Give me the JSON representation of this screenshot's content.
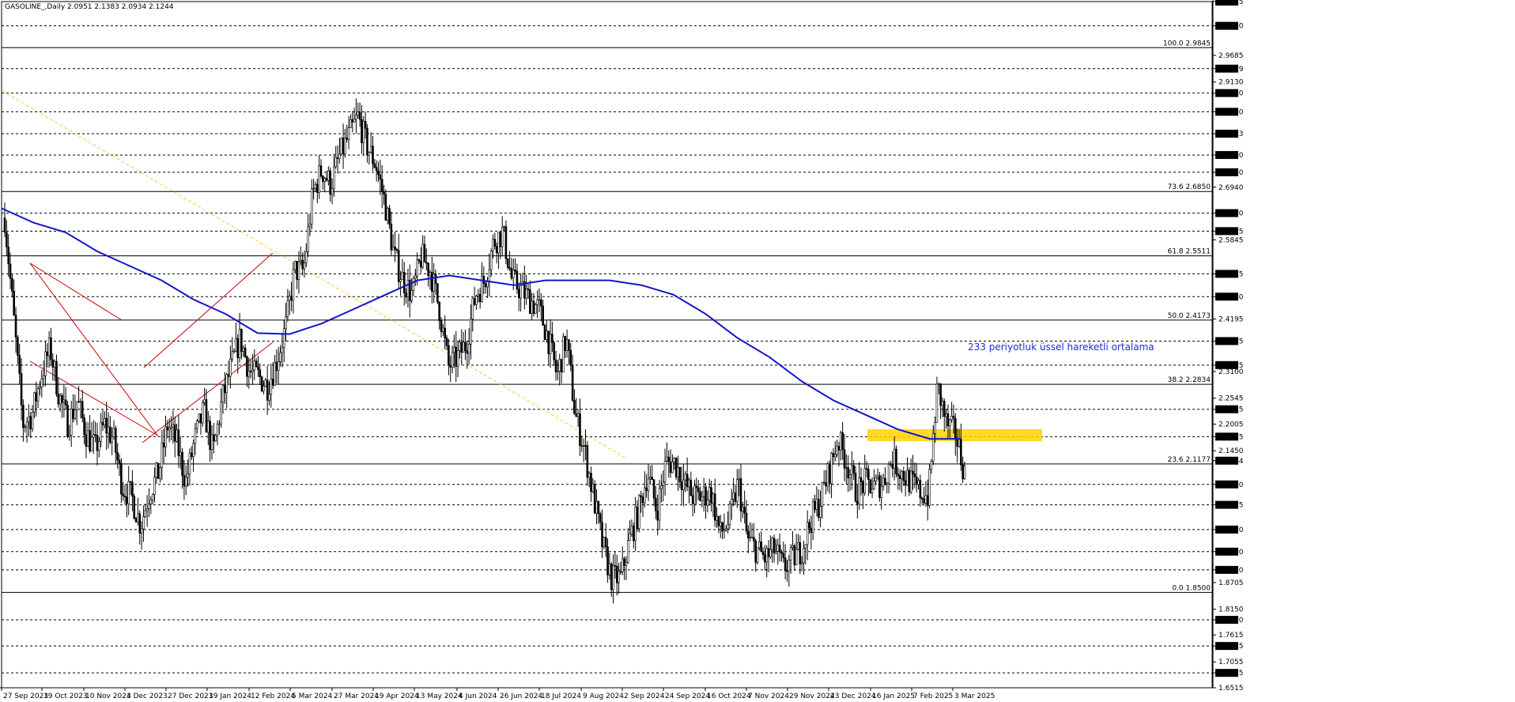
{
  "header": {
    "title": "GASOLINE_,Daily  2.0951 2.1383 2.0934 2.1244"
  },
  "chart_data": {
    "type": "candlestick",
    "symbol": "GASOLINE_",
    "timeframe": "Daily",
    "last_ohlc": {
      "open": 2.0951,
      "high": 2.1383,
      "low": 2.0934,
      "close": 2.1244
    },
    "ylim": [
      1.6515,
      3.0805
    ],
    "price_axis_ticks": [
      {
        "v": 3.0805,
        "boxed": true
      },
      {
        "v": 3.03,
        "boxed": true
      },
      {
        "v": 2.9685,
        "boxed": false
      },
      {
        "v": 2.9409,
        "boxed": true
      },
      {
        "v": 2.913,
        "boxed": false
      },
      {
        "v": 2.89,
        "boxed": true
      },
      {
        "v": 2.851,
        "boxed": true
      },
      {
        "v": 2.8053,
        "boxed": true
      },
      {
        "v": 2.761,
        "boxed": true
      },
      {
        "v": 2.725,
        "boxed": true
      },
      {
        "v": 2.694,
        "boxed": false
      },
      {
        "v": 2.64,
        "boxed": true
      },
      {
        "v": 2.6025,
        "boxed": true
      },
      {
        "v": 2.5845,
        "boxed": false
      },
      {
        "v": 2.5135,
        "boxed": true
      },
      {
        "v": 2.466,
        "boxed": true
      },
      {
        "v": 2.4195,
        "boxed": false
      },
      {
        "v": 2.3735,
        "boxed": true
      },
      {
        "v": 2.3235,
        "boxed": true
      },
      {
        "v": 2.31,
        "boxed": false
      },
      {
        "v": 2.2545,
        "boxed": false
      },
      {
        "v": 2.2315,
        "boxed": true
      },
      {
        "v": 2.2005,
        "boxed": false
      },
      {
        "v": 2.1745,
        "boxed": true
      },
      {
        "v": 2.145,
        "boxed": false
      },
      {
        "v": 2.1244,
        "boxed": true
      },
      {
        "v": 2.075,
        "boxed": true
      },
      {
        "v": 2.0325,
        "boxed": true
      },
      {
        "v": 1.981,
        "boxed": true
      },
      {
        "v": 1.935,
        "boxed": true
      },
      {
        "v": 1.897,
        "boxed": true
      },
      {
        "v": 1.8705,
        "boxed": false
      },
      {
        "v": 1.815,
        "boxed": false
      },
      {
        "v": 1.793,
        "boxed": true
      },
      {
        "v": 1.7615,
        "boxed": false
      },
      {
        "v": 1.7385,
        "boxed": true
      },
      {
        "v": 1.7055,
        "boxed": false
      },
      {
        "v": 1.6825,
        "boxed": true
      },
      {
        "v": 1.6515,
        "boxed": false
      }
    ],
    "horizontal_levels": [
      3.0805,
      3.03,
      2.9409,
      2.89,
      2.851,
      2.8053,
      2.761,
      2.725,
      2.64,
      2.6025,
      2.5135,
      2.466,
      2.3735,
      2.3235,
      2.2315,
      2.1745,
      2.075,
      2.0325,
      1.981,
      1.935,
      1.897,
      1.793,
      1.7385,
      1.6825
    ],
    "fibonacci": [
      {
        "label": "100.0 2.9845",
        "value": 2.9845
      },
      {
        "label": "73.6 2.6850",
        "value": 2.685
      },
      {
        "label": "61.8 2.5511",
        "value": 2.5511
      },
      {
        "label": "50.0 2.4173",
        "value": 2.4173
      },
      {
        "label": "38.2 2.2834",
        "value": 2.2834
      },
      {
        "label": "23.6 2.1177",
        "value": 2.1177
      },
      {
        "label": "0.0 1.8500",
        "value": 1.85
      }
    ],
    "x_ticks": [
      "27 Sep 2023",
      "19 Oct 2023",
      "10 Nov 2023",
      "4 Dec 2023",
      "27 Dec 2023",
      "19 Jan 2024",
      "12 Feb 2024",
      "5 Mar 2024",
      "27 Mar 2024",
      "19 Apr 2024",
      "13 May 2024",
      "4 Jun 2024",
      "26 Jun 2024",
      "18 Jul 2024",
      "9 Aug 2024",
      "2 Sep 2024",
      "24 Sep 2024",
      "16 Oct 2024",
      "7 Nov 2024",
      "29 Nov 2024",
      "23 Dec 2024",
      "16 Jan 2025",
      "7 Feb 2025",
      "3 Mar 2025"
    ],
    "close_path": [
      2.63,
      2.42,
      2.2,
      2.22,
      2.3,
      2.36,
      2.26,
      2.2,
      2.25,
      2.18,
      2.15,
      2.2,
      2.17,
      2.07,
      2.05,
      1.99,
      2.06,
      2.1,
      2.2,
      2.16,
      2.08,
      2.17,
      2.23,
      2.14,
      2.25,
      2.32,
      2.38,
      2.31,
      2.3,
      2.28,
      2.33,
      2.4,
      2.52,
      2.52,
      2.68,
      2.73,
      2.7,
      2.76,
      2.8,
      2.84,
      2.78,
      2.74,
      2.66,
      2.55,
      2.5,
      2.47,
      2.55,
      2.52,
      2.44,
      2.32,
      2.34,
      2.37,
      2.47,
      2.5,
      2.58,
      2.6,
      2.5,
      2.48,
      2.46,
      2.44,
      2.38,
      2.3,
      2.38,
      2.22,
      2.15,
      2.05,
      1.95,
      1.88,
      1.88,
      1.96,
      2.02,
      2.1,
      2.02,
      2.12,
      2.12,
      2.08,
      2.05,
      2.05,
      2.06,
      1.97,
      2.0,
      2.08,
      1.96,
      1.94,
      1.92,
      1.94,
      1.9,
      1.92,
      1.94,
      2.0,
      2.04,
      2.1,
      2.17,
      2.12,
      2.06,
      2.08,
      2.07,
      2.08,
      2.13,
      2.1,
      2.08,
      2.06,
      2.05,
      2.28,
      2.2,
      2.18,
      2.1
    ],
    "ema": {
      "label": "233 periyotluk üssel hareketli ortalama",
      "color": "#1414c8",
      "points": [
        2.65,
        2.62,
        2.6,
        2.56,
        2.53,
        2.5,
        2.46,
        2.43,
        2.39,
        2.388,
        2.41,
        2.44,
        2.47,
        2.5,
        2.51,
        2.5,
        2.49,
        2.5,
        2.5,
        2.5,
        2.49,
        2.47,
        2.43,
        2.38,
        2.34,
        2.29,
        2.25,
        2.22,
        2.19,
        2.17,
        2.17
      ]
    },
    "highlight_zone": {
      "from": 2.165,
      "to": 2.19,
      "color": "#ffd400"
    },
    "colors": {
      "candle": "#000000",
      "channel": "#cc0000",
      "trend": "#f5c842",
      "ema": "#1414c8",
      "annotation": "#1e2bd6"
    }
  }
}
